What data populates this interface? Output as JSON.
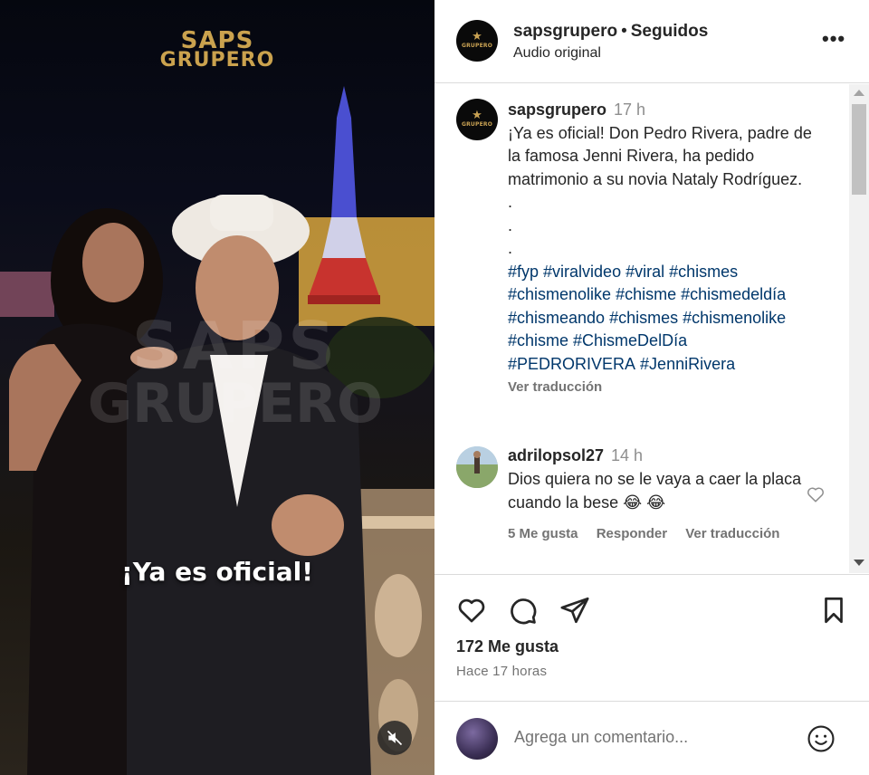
{
  "media": {
    "logo_line1": "SAPS",
    "logo_line2": "GRUPERO",
    "watermark_line1": "SAPS",
    "watermark_line2": "GRUPERO",
    "caption_overlay": "¡Ya es oficial!",
    "mute_icon": "speaker-muted-icon"
  },
  "header": {
    "avatar_text": "GRUPERO",
    "username": "sapsgrupero",
    "separator": "•",
    "follow_status": "Seguidos",
    "subtitle": "Audio original",
    "more_icon": "more-horizontal-icon",
    "more_label": "•••"
  },
  "caption": {
    "username": "sapsgrupero",
    "time": "17 h",
    "text": "¡Ya es oficial! Don Pedro Rivera, padre de la famosa Jenni Rivera, ha pedido matrimonio a su novia Nataly Rodríguez.",
    "dots": [
      ".",
      ".",
      "."
    ],
    "hashtags": [
      "#fyp",
      "#viralvideo",
      "#viral",
      "#chismes",
      "#chismenolike",
      "#chisme",
      "#chismedeldía",
      "#chismeando",
      "#chismes",
      "#chismenolike",
      "#chisme",
      "#ChismeDelDía",
      "#PEDRORIVERA",
      "#JenniRivera"
    ],
    "translate": "Ver traducción"
  },
  "comment": {
    "username": "adrilopsol27",
    "time": "14 h",
    "text": "Dios quiera no se le vaya a caer la placa cuando la bese 😂 😂",
    "likes": "5 Me gusta",
    "reply": "Responder",
    "translate": "Ver traducción"
  },
  "actions": {
    "like_icon": "heart-icon",
    "comment_icon": "comment-icon",
    "share_icon": "send-icon",
    "save_icon": "bookmark-icon",
    "likes_count": "172 Me gusta",
    "time_ago": "Hace 17 horas"
  },
  "add_comment": {
    "placeholder": "Agrega un comentario...",
    "emoji_icon": "emoji-icon"
  },
  "colors": {
    "logo_gold": "#caa24e",
    "hashtag_blue": "#00376b",
    "muted_text": "#737373"
  }
}
